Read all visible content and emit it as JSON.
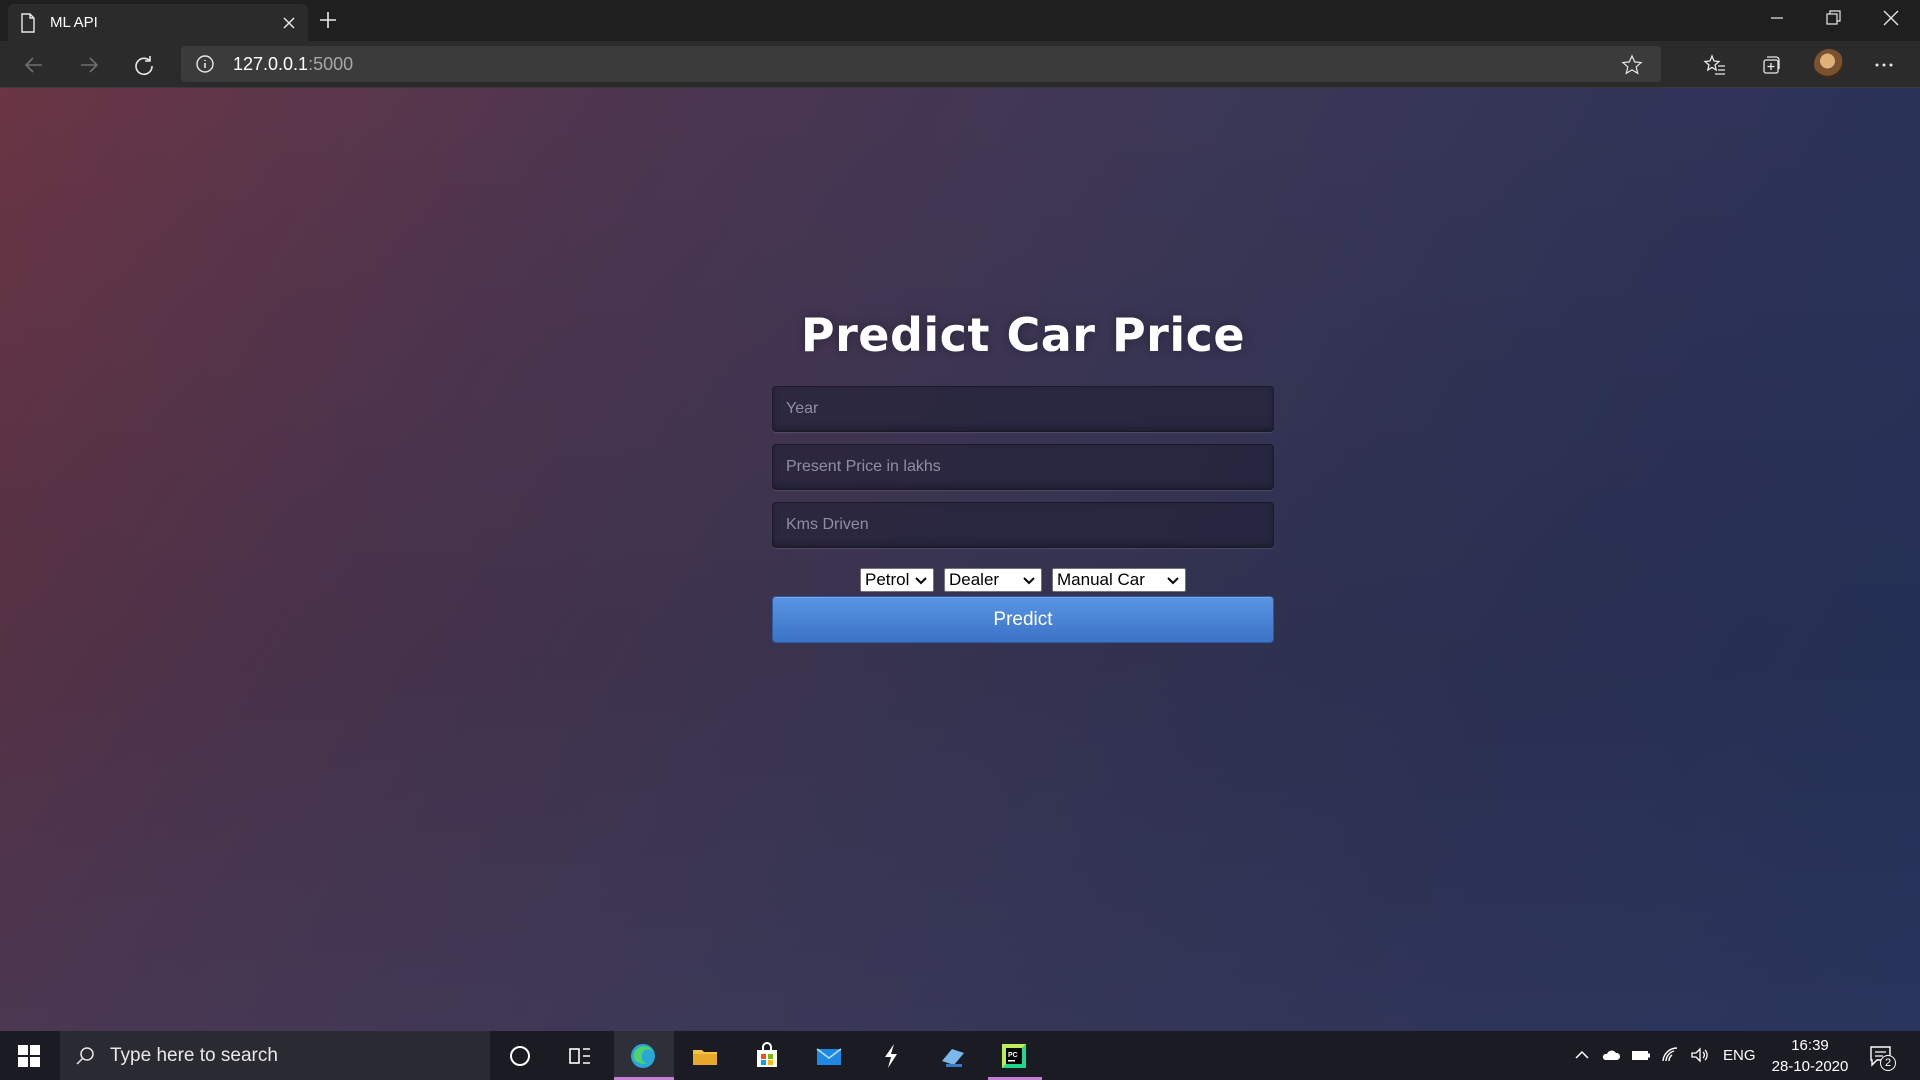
{
  "browser": {
    "tab_title": "ML API",
    "url_host": "127.0.0.1",
    "url_port": ":5000"
  },
  "page": {
    "title": "Predict Car Price",
    "fields": {
      "year_placeholder": "Year",
      "price_placeholder": "Present Price in lakhs",
      "kms_placeholder": "Kms Driven"
    },
    "selects": {
      "fuel": "Petrol",
      "seller": "Dealer",
      "transmission": "Manual Car"
    },
    "predict_label": "Predict"
  },
  "taskbar": {
    "search_placeholder": "Type here to search",
    "language": "ENG",
    "time": "16:39",
    "date": "28-10-2020",
    "notification_count": "2"
  },
  "colors": {
    "predict_button": "#4a84d6",
    "taskbar_active": "#c77dd6"
  }
}
